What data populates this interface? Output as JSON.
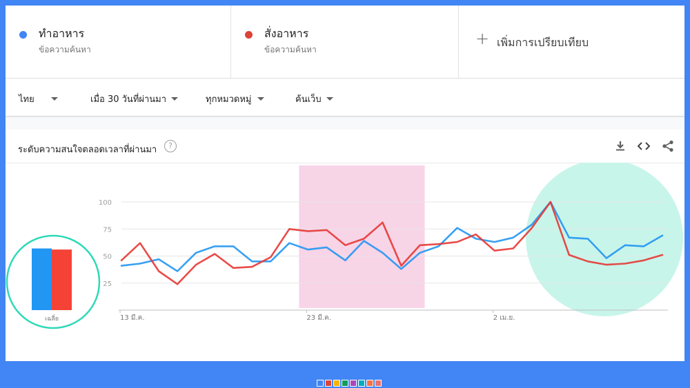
{
  "compare": {
    "terms": [
      {
        "name": "ทำอาหาร",
        "sub": "ข้อความค้นหา",
        "color": "#4285f4"
      },
      {
        "name": "สั่งอาหาร",
        "sub": "ข้อความค้นหา",
        "color": "#db4437"
      }
    ],
    "add_label": "เพิ่มการเปรียบเทียบ",
    "add_icon": "plus-icon"
  },
  "filters": {
    "region": "ไทย",
    "time": "เมื่อ 30 วันที่ผ่านมา",
    "category": "ทุกหมวดหมู่",
    "search_type": "ค้นเว็บ"
  },
  "card": {
    "title": "ระดับความสนใจตลอดเวลาที่ผ่านมา",
    "help_icon": "question-icon",
    "tools": [
      "download-icon",
      "embed-icon",
      "share-icon"
    ]
  },
  "palette": [
    "#4285f4",
    "#db4437",
    "#f4b400",
    "#0f9d58",
    "#ab47bc",
    "#00acc1",
    "#ff7043",
    "#e57373"
  ],
  "chart_data": [
    {
      "type": "bar",
      "categories": [
        "เฉลี่ย"
      ],
      "series": [
        {
          "name": "ทำอาหาร",
          "values": [
            57
          ]
        },
        {
          "name": "สั่งอาหาร",
          "values": [
            56
          ]
        }
      ],
      "colors": [
        "#2196f3",
        "#f44336"
      ],
      "highlight": {
        "shape": "circle",
        "color": "#2ed9b8"
      }
    },
    {
      "type": "line",
      "x": [
        "13 มี.ค.",
        "14 มี.ค.",
        "15 มี.ค.",
        "16 มี.ค.",
        "17 มี.ค.",
        "18 มี.ค.",
        "19 มี.ค.",
        "20 มี.ค.",
        "21 มี.ค.",
        "22 มี.ค.",
        "23 มี.ค.",
        "24 มี.ค.",
        "25 มี.ค.",
        "26 มี.ค.",
        "27 มี.ค.",
        "28 มี.ค.",
        "29 มี.ค.",
        "30 มี.ค.",
        "31 มี.ค.",
        "1 เม.ย.",
        "2 เม.ย.",
        "3 เม.ย.",
        "4 เม.ย.",
        "5 เม.ย.",
        "6 เม.ย.",
        "7 เม.ย.",
        "8 เม.ย.",
        "9 เม.ย.",
        "10 เม.ย.",
        "11 เม.ย.",
        "12 เม.ย."
      ],
      "x_tick_labels": [
        "13 มี.ค.",
        "23 มี.ค.",
        "2 เม.ย."
      ],
      "x_tick_indices": [
        0,
        10,
        20
      ],
      "series": [
        {
          "name": "ทำอาหาร",
          "color": "#2196f3",
          "values": [
            41,
            43,
            47,
            36,
            53,
            59,
            59,
            45,
            45,
            62,
            56,
            58,
            46,
            64,
            53,
            38,
            53,
            59,
            76,
            66,
            63,
            67,
            79,
            100,
            67,
            66,
            48,
            60,
            59,
            69,
            null
          ]
        },
        {
          "name": "สั่งอาหาร",
          "color": "#e53935",
          "values": [
            46,
            62,
            36,
            24,
            42,
            52,
            39,
            40,
            49,
            75,
            73,
            74,
            60,
            66,
            81,
            41,
            60,
            61,
            63,
            70,
            55,
            57,
            76,
            100,
            51,
            45,
            42,
            43,
            46,
            51,
            null
          ]
        }
      ],
      "ylim": [
        0,
        100
      ],
      "y_ticks": [
        25,
        50,
        75,
        100
      ],
      "highlights": [
        {
          "type": "band",
          "from": "23 มี.ค.",
          "to": "29 มี.ค.",
          "color": "#f8d4e7"
        },
        {
          "type": "circle",
          "around": "7 เม.ย. – 12 เม.ย.",
          "color": "#c8f5ea"
        }
      ]
    }
  ]
}
